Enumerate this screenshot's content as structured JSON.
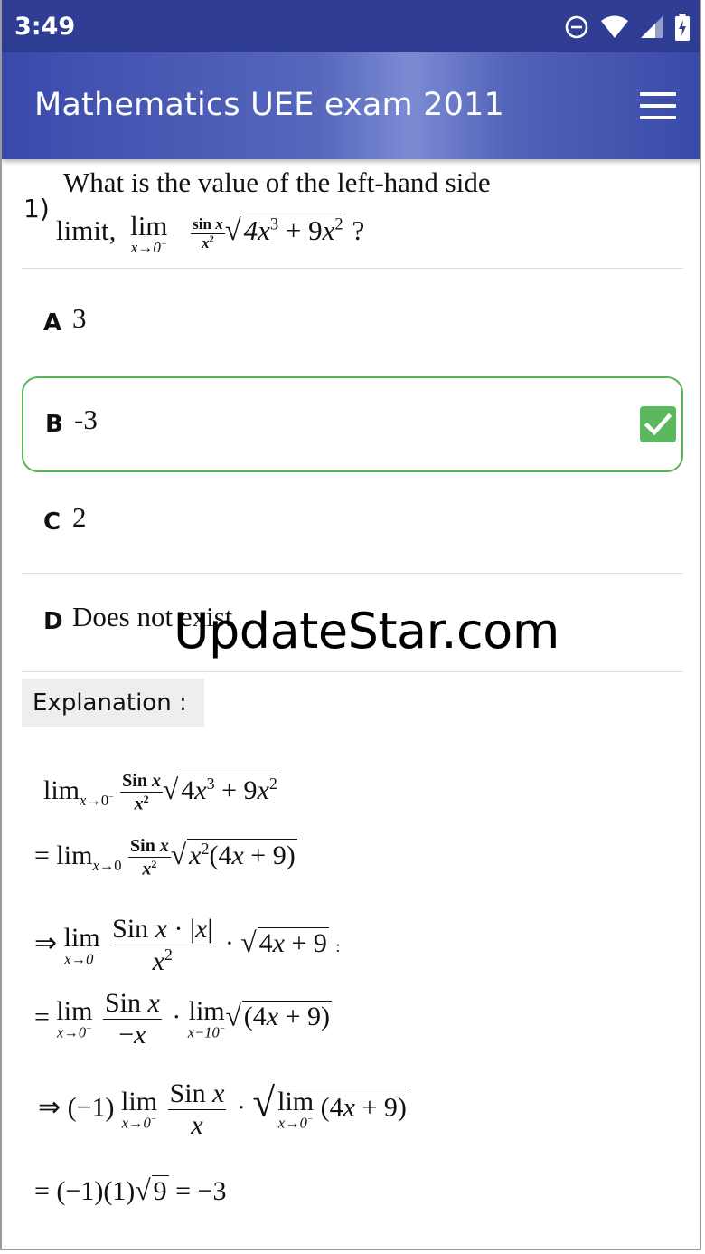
{
  "status_bar": {
    "time": "3:49",
    "icons": [
      "do-not-disturb-icon",
      "wifi-icon",
      "signal-icon",
      "battery-icon"
    ]
  },
  "app_bar": {
    "title": "Mathematics UEE exam 2011",
    "menu_icon": "hamburger-menu-icon"
  },
  "question": {
    "number": "1)",
    "text_line1": "What is the value of the left-hand side",
    "text_line2_prefix": "limit,",
    "text_line2_suffix": "?"
  },
  "options": [
    {
      "letter": "A",
      "text": "3",
      "selected": false
    },
    {
      "letter": "B",
      "text": "-3",
      "selected": true
    },
    {
      "letter": "C",
      "text": "2",
      "selected": false
    },
    {
      "letter": "D",
      "text": "Does not exist",
      "selected": false
    }
  ],
  "watermark": "UpdateStar.com",
  "explanation": {
    "label": "Explanation :"
  },
  "colors": {
    "status_bar": "#2f3d95",
    "app_bar": "#3f51b5",
    "selected_border": "#58b45a",
    "check": "#5cb85c"
  }
}
